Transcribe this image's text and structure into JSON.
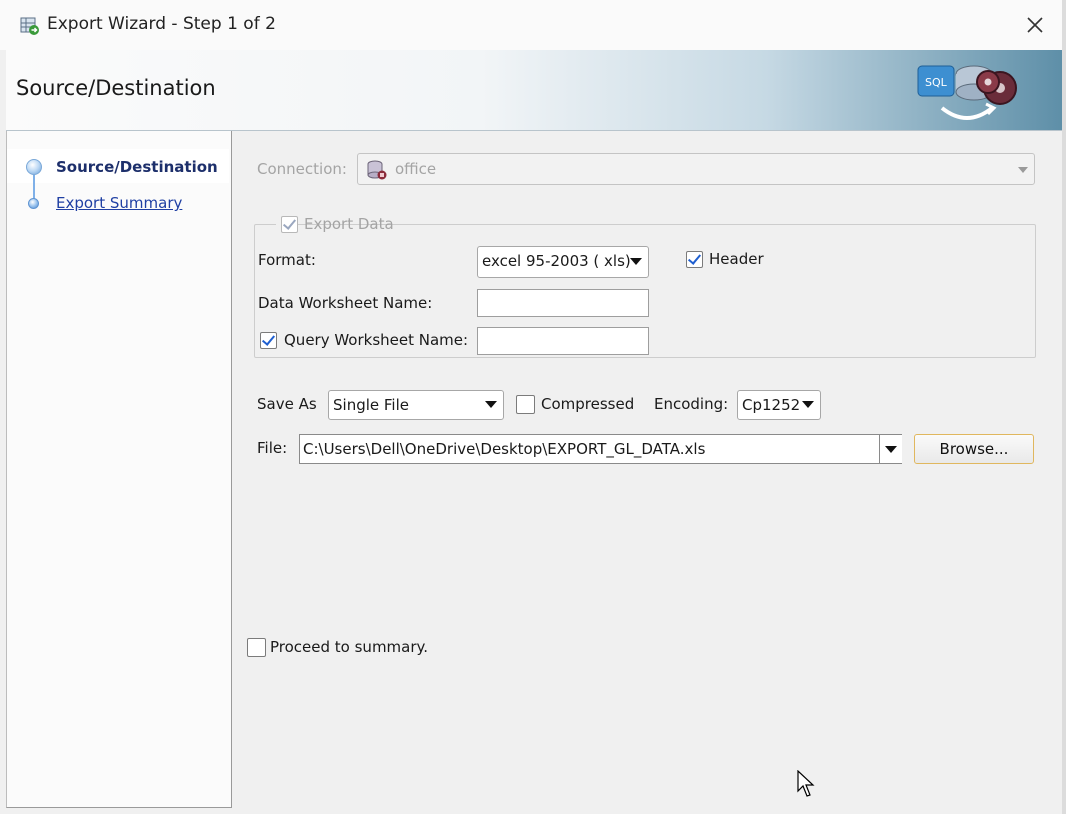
{
  "window": {
    "title": "Export Wizard - Step 1 of 2"
  },
  "banner": {
    "title": "Source/Destination",
    "art_label": "SQL"
  },
  "steps": [
    {
      "label": "Source/Destination",
      "state": "selected"
    },
    {
      "label": "Export Summary",
      "state": "link"
    }
  ],
  "connection": {
    "label": "Connection:",
    "value": "office",
    "enabled": false
  },
  "export_data": {
    "label": "Export Data",
    "checked": true,
    "enabled": false
  },
  "format": {
    "label": "Format:",
    "value": "excel 95-2003 ( xls)"
  },
  "header_option": {
    "label": "Header",
    "checked": true
  },
  "data_worksheet": {
    "label": "Data Worksheet Name:",
    "value": ""
  },
  "query_worksheet": {
    "label": "Query Worksheet Name:",
    "checked": true,
    "value": ""
  },
  "save_as": {
    "label": "Save As",
    "value": "Single File"
  },
  "compressed": {
    "label": "Compressed",
    "checked": false
  },
  "encoding": {
    "label": "Encoding:",
    "value": "Cp1252"
  },
  "file": {
    "label": "File:",
    "value": "C:\\Users\\Dell\\OneDrive\\Desktop\\EXPORT_GL_DATA.xls",
    "browse_label": "Browse..."
  },
  "proceed": {
    "label": "Proceed to summary.",
    "checked": false
  },
  "colors": {
    "accent_link": "#1f3fa3",
    "selected_step_text": "#1d2f6b",
    "check_mark": "#1f5fd0",
    "browse_border": "#e0b75e"
  }
}
